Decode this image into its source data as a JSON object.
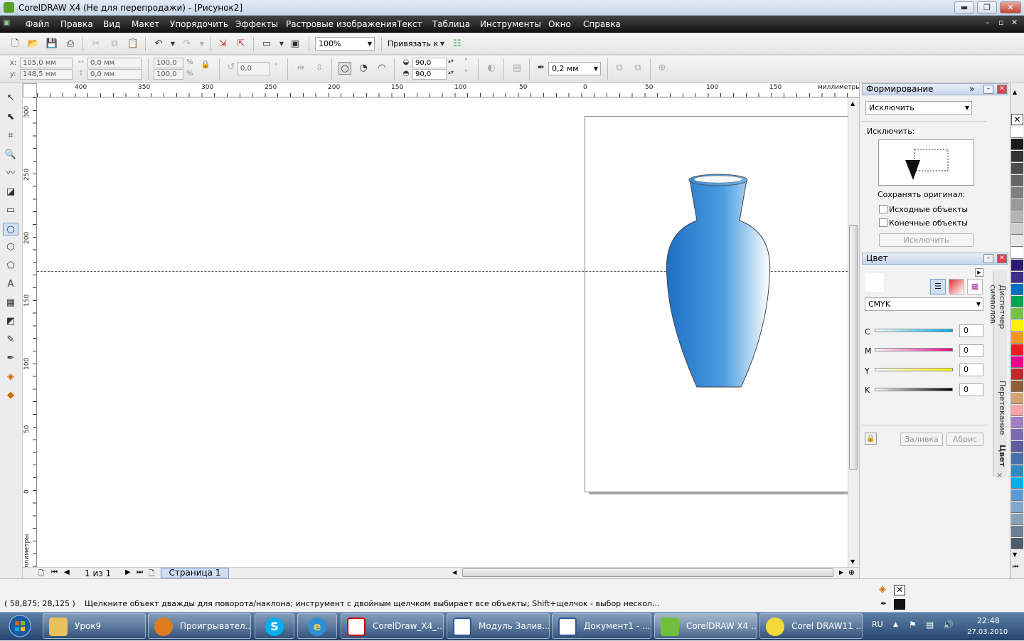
{
  "window": {
    "title": "CorelDRAW X4 (Не для перепродажи) - [Рисунок2]",
    "min": "▬",
    "max": "❐",
    "close": "✕"
  },
  "menu": [
    "Файл",
    "Правка",
    "Вид",
    "Макет",
    "Упорядочить",
    "Эффекты",
    "Растровые изображения",
    "Текст",
    "Таблица",
    "Инструменты",
    "Окно",
    "Справка"
  ],
  "standard": {
    "zoom": "100%",
    "snap": "Привязать к"
  },
  "property": {
    "x": "105,0 мм",
    "y": "148,5 мм",
    "w": "0,0 мм",
    "h": "0,0 мм",
    "sx": "100,0",
    "sy": "100,0",
    "pct": "%",
    "rot": "0,0",
    "deg": "°",
    "a1": "90,0",
    "a2": "90,0",
    "outline": "0,2 мм"
  },
  "ruler": {
    "unit_h": "миллиметры",
    "unit_v": "миллиметры",
    "h": [
      "400",
      "350",
      "300",
      "250",
      "200",
      "150",
      "100",
      "50",
      "0",
      "50",
      "100",
      "150"
    ],
    "v": [
      "300",
      "250",
      "200",
      "150",
      "100",
      "50",
      "0"
    ]
  },
  "pages": {
    "count": "1 из 1",
    "tab": "Страница 1"
  },
  "shaping": {
    "title": "Формирование",
    "mode": "Исключить",
    "label": "Исключить:",
    "keep": "Сохранять оригинал:",
    "src": "Исходные объекты",
    "dst": "Конечные объекты",
    "apply": "Исключить"
  },
  "color": {
    "title": "Цвет",
    "model": "CMYK",
    "channels": [
      {
        "k": "C",
        "v": "0"
      },
      {
        "k": "M",
        "v": "0"
      },
      {
        "k": "Y",
        "v": "0"
      },
      {
        "k": "K",
        "v": "0"
      }
    ],
    "fill": "Заливка",
    "outline": "Абрис"
  },
  "vtabs": {
    "t1": "Диспетчер символов",
    "t2": "Перетекание",
    "t3": "Цвет"
  },
  "palette": [
    "#ffffff",
    "#1a1a1a",
    "#333333",
    "#4d4d4d",
    "#666666",
    "#808080",
    "#999999",
    "#b3b3b3",
    "#cccccc",
    "#e6e6e6",
    "#ffffff",
    "#2e1a6e",
    "#3e2f8f",
    "#0070c0",
    "#00a651",
    "#76c043",
    "#fff200",
    "#f7941d",
    "#ed1c24",
    "#ec008c",
    "#c1272d",
    "#8b5e3c",
    "#d4a373",
    "#f4a6a6",
    "#9e7fbf",
    "#7b6cb0",
    "#5c5c9e",
    "#4a6fa5",
    "#2e8bc0",
    "#00aeef",
    "#5b9bd5",
    "#7fa6c8",
    "#8ca0b4",
    "#6d7f92",
    "#4f5d6b"
  ],
  "status": {
    "coords": "( 58,875; 28,125 )",
    "hint": "Щелкните объект дважды для поворота/наклона; инструмент с двойным щелчком выбирает все объекты; Shift+щелчок - выбор нескол..."
  },
  "taskbar": {
    "items": [
      "Урок9",
      "Проигрывател...",
      "",
      "",
      "CorelDraw_X4_...",
      "Модуль Залив...",
      "Документ1 - ...",
      "CorelDRAW X4 ...",
      "Corel DRAW11 ..."
    ],
    "lang": "RU",
    "time": "22:48",
    "date": "27.03.2010"
  }
}
